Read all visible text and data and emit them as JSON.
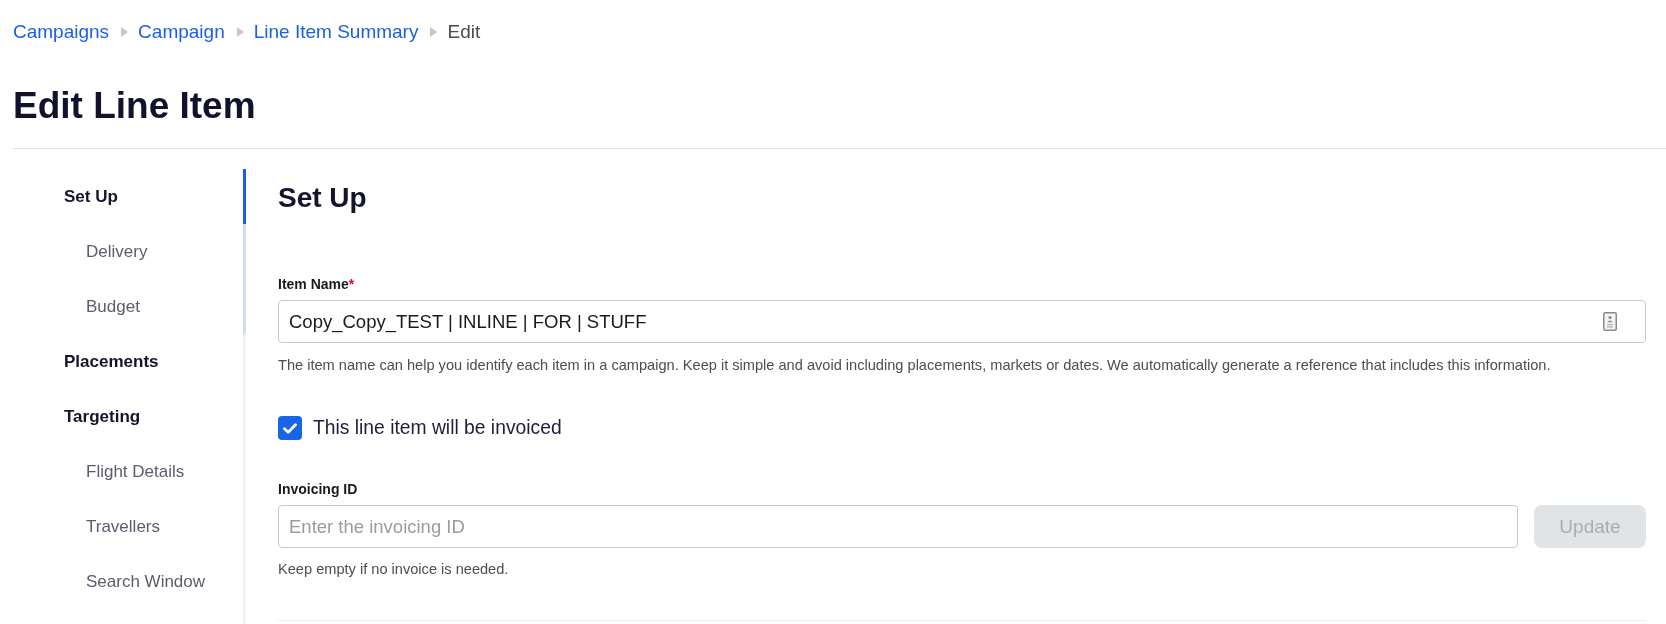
{
  "breadcrumb": [
    {
      "label": "Campaigns",
      "kind": "link"
    },
    {
      "label": "Campaign",
      "kind": "link"
    },
    {
      "label": "Line Item Summary",
      "kind": "link"
    },
    {
      "label": "Edit",
      "kind": "current"
    }
  ],
  "page_title": "Edit Line Item",
  "sidebar": {
    "items": [
      {
        "label": "Set Up",
        "selected": true,
        "children": [
          {
            "label": "Delivery",
            "selected": false
          },
          {
            "label": "Budget",
            "selected": false
          }
        ]
      },
      {
        "label": "Placements",
        "selected": false
      },
      {
        "label": "Targeting",
        "selected": false,
        "children": [
          {
            "label": "Flight Details",
            "selected": false
          },
          {
            "label": "Travellers",
            "selected": false
          },
          {
            "label": "Search Window",
            "selected": false
          }
        ]
      }
    ]
  },
  "section": {
    "title": "Set Up",
    "item_name": {
      "label": "Item Name",
      "required_mark": "*",
      "value": "Copy_Copy_TEST | INLINE | FOR | STUFF",
      "help": "The item name can help you identify each item in a campaign. Keep it simple and avoid including placements, markets or dates. We automatically generate a reference that includes this information."
    },
    "invoiced": {
      "label": "This line item will be invoiced",
      "checked": true
    },
    "invoicing_id": {
      "label": "Invoicing ID",
      "placeholder": "Enter the invoicing ID",
      "help": "Keep empty if no invoice is needed.",
      "button": {
        "label": "Update",
        "disabled": true
      }
    }
  }
}
